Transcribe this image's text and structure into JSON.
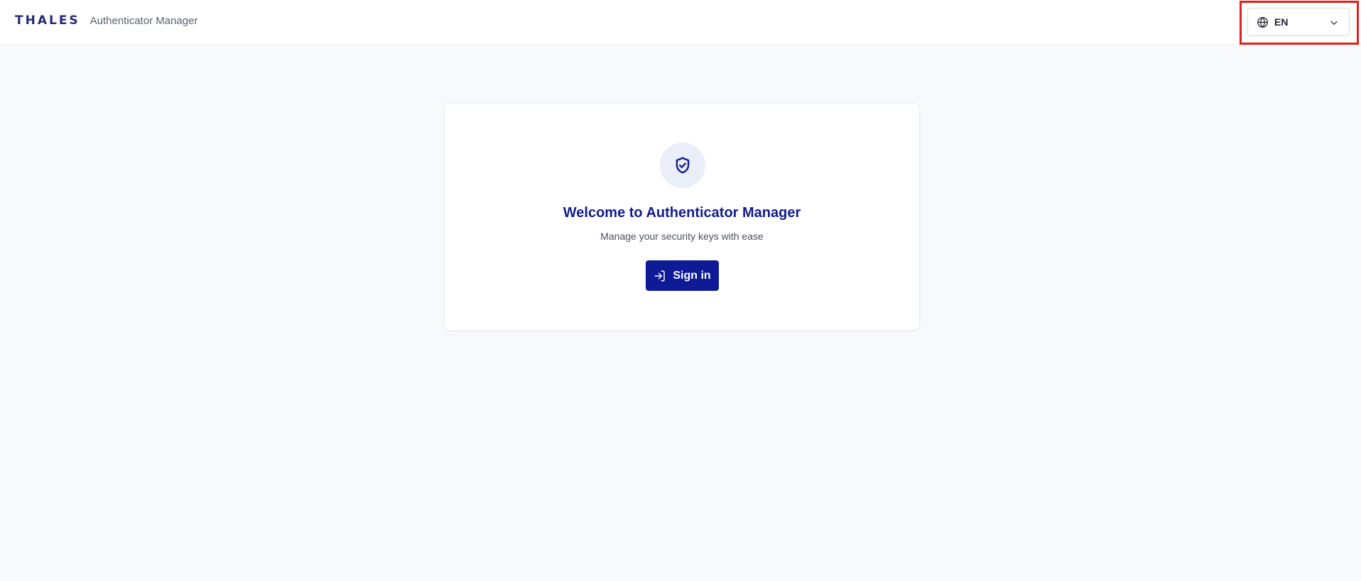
{
  "header": {
    "logo_text": "THALES",
    "app_name": "Authenticator Manager"
  },
  "language_selector": {
    "icon": "globe-icon",
    "value": "EN",
    "dropdown_icon": "chevron-down-icon",
    "highlight_color": "#e0201c"
  },
  "welcome_card": {
    "icon": "shield-check-icon",
    "title": "Welcome to Authenticator Manager",
    "subtitle": "Manage your security keys with ease",
    "sign_in_icon": "sign-in-icon",
    "sign_in_label": "Sign in"
  },
  "colors": {
    "brand_navy": "#242a75",
    "primary_button": "#0e1a96",
    "title": "#131c8c",
    "background": "#f8f9fb"
  }
}
